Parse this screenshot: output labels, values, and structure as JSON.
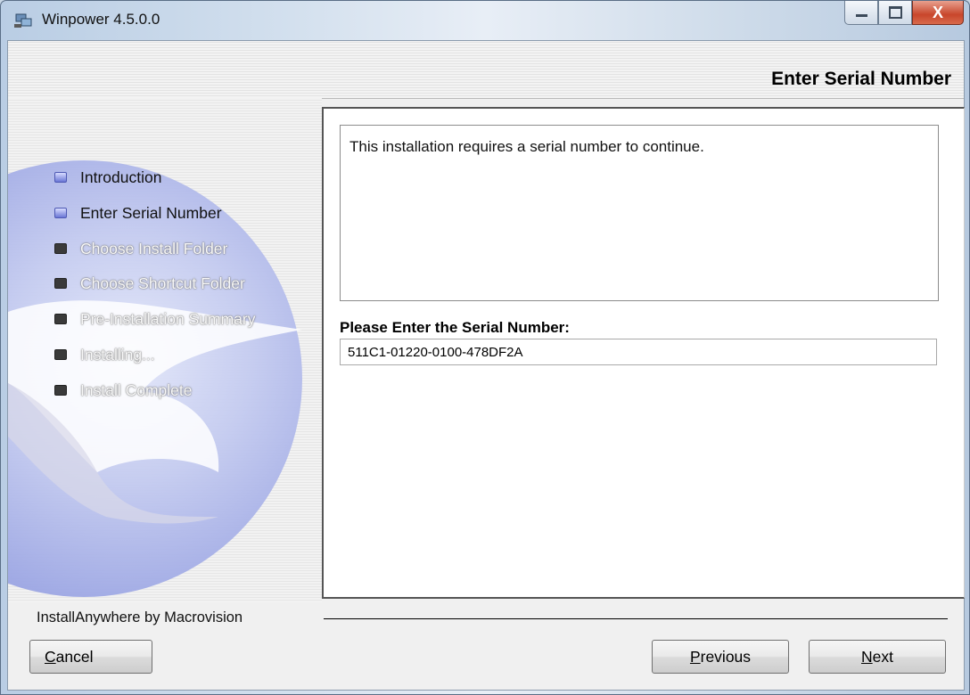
{
  "window": {
    "title": "Winpower 4.5.0.0",
    "icon": "app-computer-icon",
    "controls": {
      "minimize": "minimize-icon",
      "maximize": "maximize-icon",
      "close": "close-icon",
      "close_glyph": "X"
    }
  },
  "header": {
    "title": "Enter Serial Number"
  },
  "steps": [
    {
      "label": "Introduction",
      "state": "done"
    },
    {
      "label": "Enter Serial Number",
      "state": "done"
    },
    {
      "label": "Choose Install Folder",
      "state": "todo"
    },
    {
      "label": "Choose Shortcut Folder",
      "state": "todo"
    },
    {
      "label": "Pre-Installation Summary",
      "state": "todo"
    },
    {
      "label": "Installing...",
      "state": "todo"
    },
    {
      "label": "Install Complete",
      "state": "todo"
    }
  ],
  "content": {
    "message": "This installation requires a serial number to continue.",
    "serial_label": "Please Enter the Serial Number:",
    "serial_value": "511C1-01220-0100-478DF2A"
  },
  "footer": {
    "brand": "InstallAnywhere by Macrovision",
    "cancel": {
      "mnemonic": "C",
      "rest": "ancel"
    },
    "previous": {
      "mnemonic": "P",
      "rest": "revious"
    },
    "next": {
      "mnemonic": "N",
      "rest": "ext"
    }
  },
  "colors": {
    "step_done_bullet": "#6a76d6",
    "step_todo_bullet": "#3a3a3a",
    "close_button": "#c8462b"
  }
}
